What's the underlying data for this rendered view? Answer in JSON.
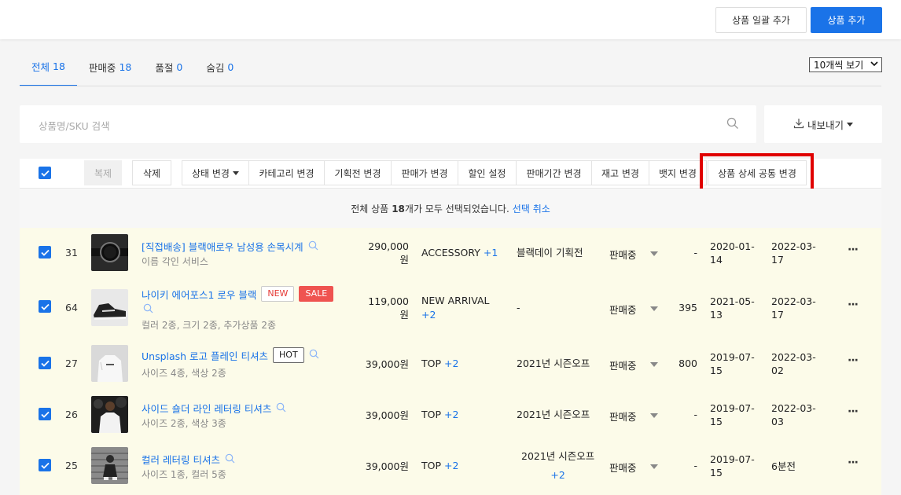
{
  "header": {
    "bulk_add_label": "상품 일괄 추가",
    "add_label": "상품 추가"
  },
  "tabs": [
    {
      "label": "전체",
      "count": "18"
    },
    {
      "label": "판매중",
      "count": "18"
    },
    {
      "label": "품절",
      "count": "0"
    },
    {
      "label": "숨김",
      "count": "0"
    }
  ],
  "view_select": {
    "value": "10개씩 보기"
  },
  "search": {
    "placeholder": "상품명/SKU 검색"
  },
  "export": {
    "label": "내보내기"
  },
  "toolbar": {
    "copy": "복제",
    "delete": "삭제",
    "status_change": "상태 변경",
    "category_change": "카테고리 변경",
    "promotion_change": "기획전 변경",
    "price_change": "판매가 변경",
    "discount": "할인 설정",
    "period_change": "판매기간 변경",
    "stock_change": "재고 변경",
    "badge_change": "뱃지 변경",
    "detail_common_change": "상품 상세 공통 변경"
  },
  "notice": {
    "prefix": "전체 상품",
    "count": "18",
    "suffix": "개가 모두 선택되었습니다.",
    "cancel": "선택 취소"
  },
  "accent": "#1a73e8",
  "rows": [
    {
      "num": "31",
      "name": "[직접배송] 블랙애로우 남성용 손목시계",
      "sub": "이름 각인 서비스",
      "price1": "290,000",
      "price2": "원",
      "cat": "ACCESSORY",
      "cat_plus": "+1",
      "promo": "블랙데이 기획전",
      "promo_plus": "",
      "status": "판매중",
      "stock": "-",
      "d1a": "2020-01-",
      "d1b": "14",
      "d2a": "2022-03-",
      "d2b": "17"
    },
    {
      "num": "64",
      "name": "나이키 에어포스1 로우 블랙",
      "badge1": "NEW",
      "badge2": "SALE",
      "sub": "컬러 2종, 크기 2종, 추가상품 2종",
      "price1": "119,000",
      "price2": "원",
      "cat": "NEW ARRIVAL",
      "cat_plus": "+2",
      "promo": "-",
      "promo_plus": "",
      "status": "판매중",
      "stock": "395",
      "d1a": "2021-05-",
      "d1b": "13",
      "d2a": "2022-03-",
      "d2b": "17"
    },
    {
      "num": "27",
      "name": "Unsplash 로고 플레인 티셔츠",
      "badge1": "HOT",
      "sub": "사이즈 4종, 색상 2종",
      "price1": "39,000원",
      "price2": "",
      "cat": "TOP",
      "cat_plus": "+2",
      "promo": "2021년 시즌오프",
      "promo_plus": "",
      "status": "판매중",
      "stock": "800",
      "d1a": "2019-07-",
      "d1b": "15",
      "d2a": "2022-03-",
      "d2b": "02"
    },
    {
      "num": "26",
      "name": "사이드 숄더 라인 레터링 티셔츠",
      "sub": "사이즈 2종, 색상 3종",
      "price1": "39,000원",
      "price2": "",
      "cat": "TOP",
      "cat_plus": "+2",
      "promo": "2021년 시즌오프",
      "promo_plus": "",
      "status": "판매중",
      "stock": "-",
      "d1a": "2019-07-",
      "d1b": "15",
      "d2a": "2022-03-",
      "d2b": "03"
    },
    {
      "num": "25",
      "name": "컬러 레터링 티셔츠",
      "sub": "사이즈 1종, 컬러 5종",
      "price1": "39,000원",
      "price2": "",
      "cat": "TOP",
      "cat_plus": "+2",
      "promo": "2021년 시즌오프",
      "promo_plus": "+2",
      "status": "판매중",
      "stock": "-",
      "d1a": "2019-07-",
      "d1b": "15",
      "d2a": "6분전",
      "d2b": ""
    }
  ]
}
